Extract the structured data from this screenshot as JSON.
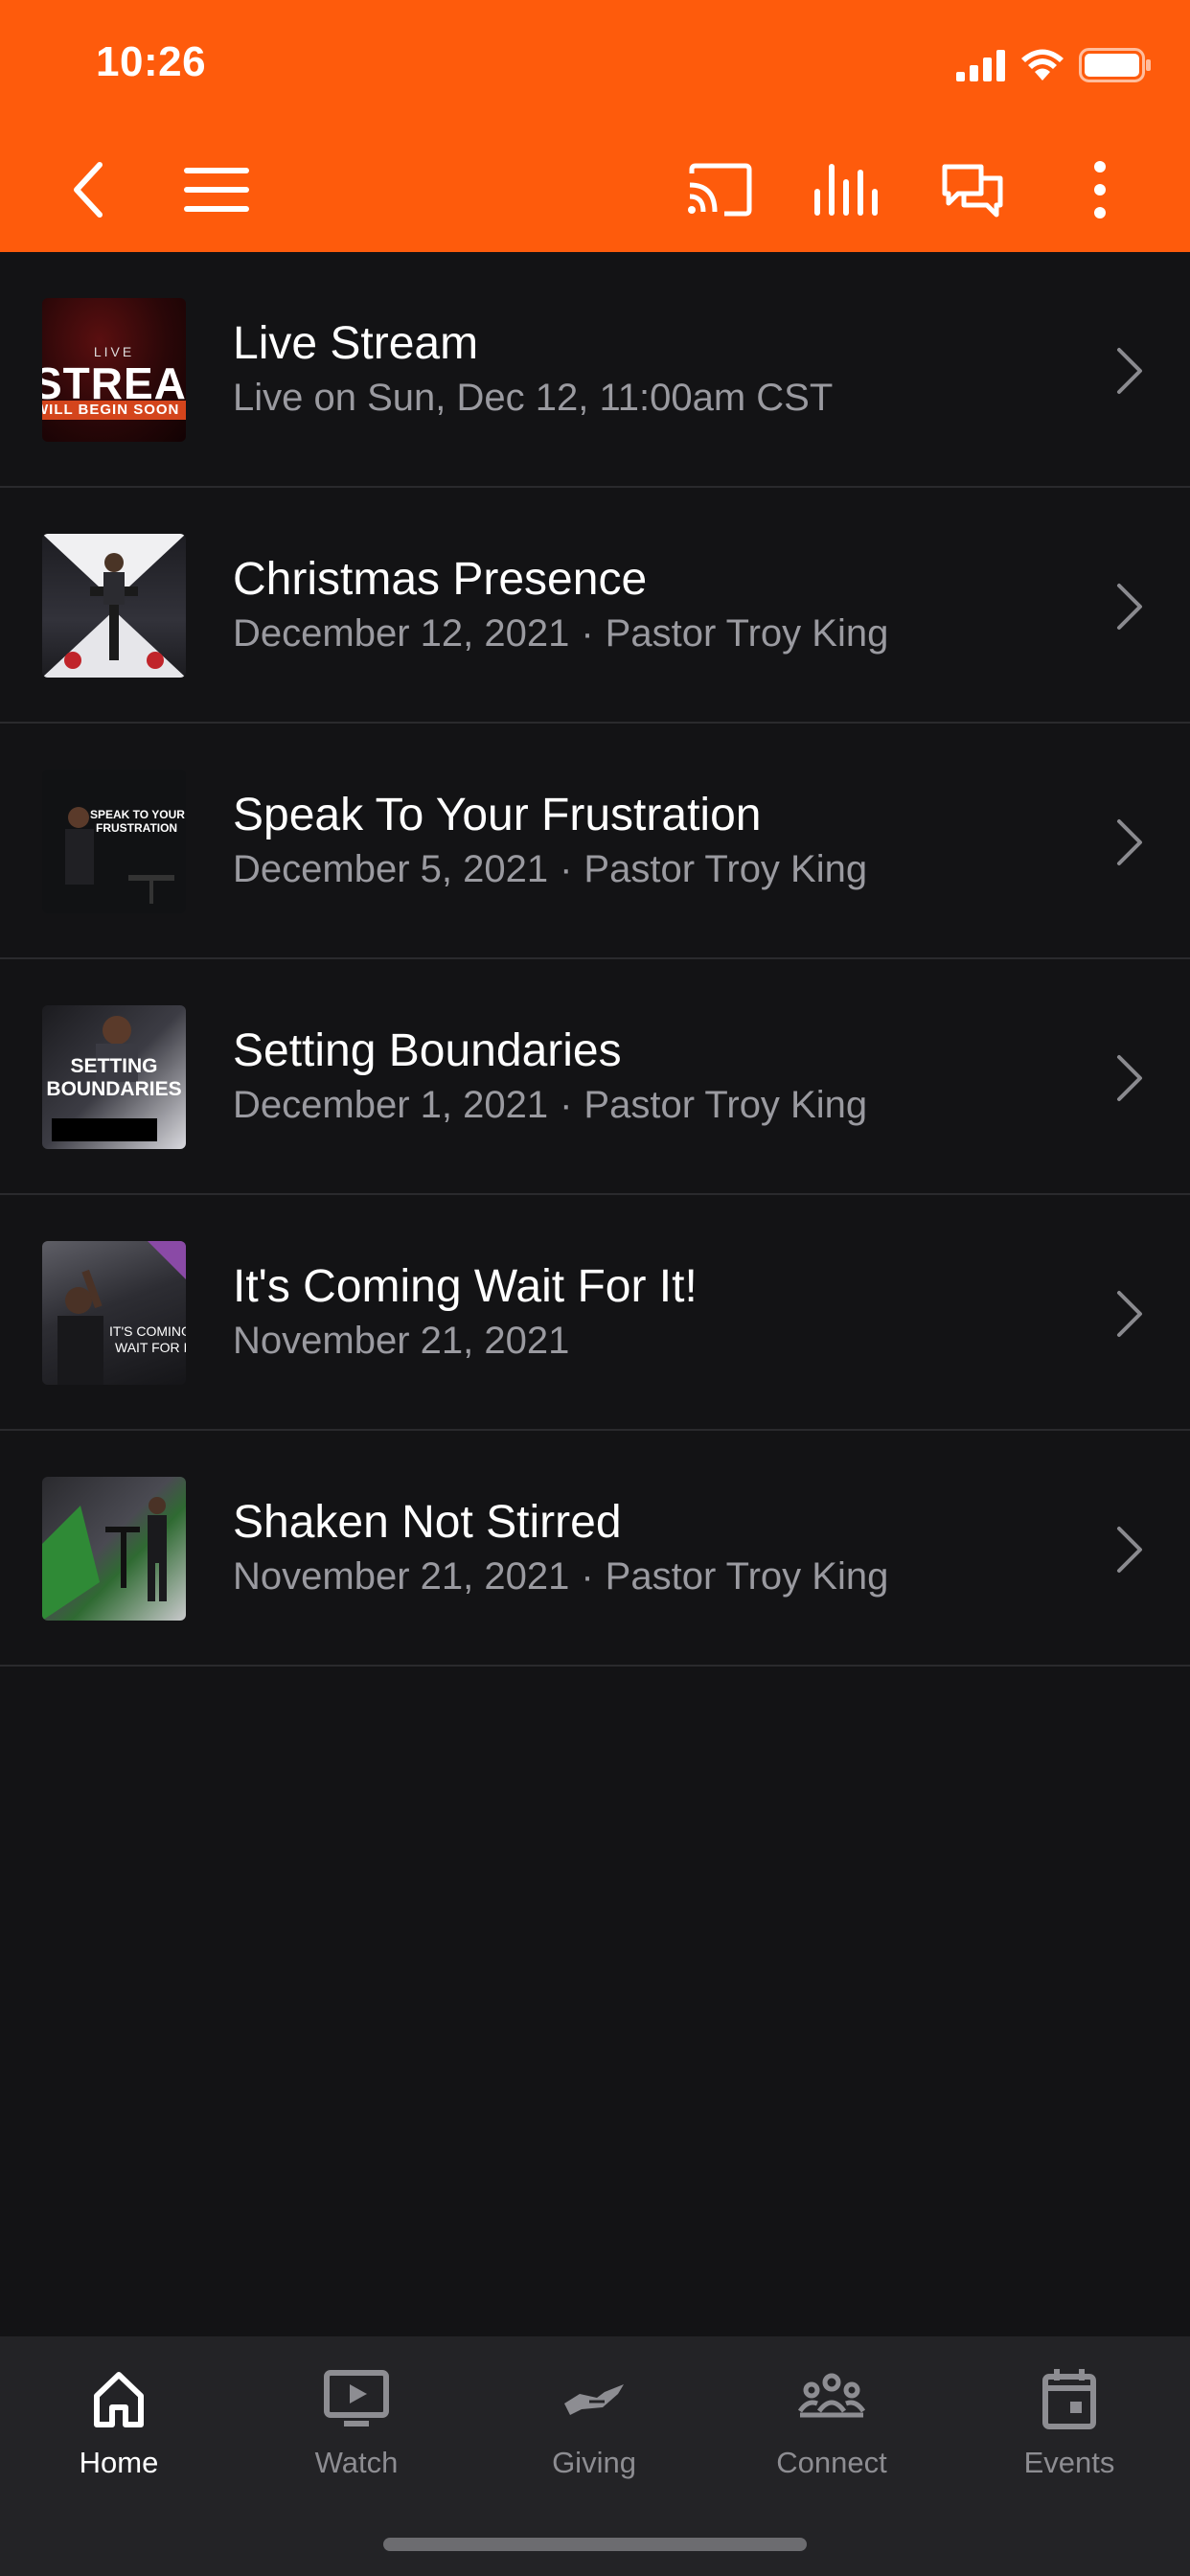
{
  "status_bar": {
    "time": "10:26"
  },
  "toolbar_icons": [
    "back-icon",
    "menu-icon",
    "cast-icon",
    "audio-icon",
    "chat-icon",
    "more-icon"
  ],
  "colors": {
    "accent": "#fe5b0c",
    "background": "#131315",
    "tabbar": "#232326",
    "subtitle": "#9a9aa0"
  },
  "items": [
    {
      "title": "Live Stream",
      "subtitle": "Live on Sun, Dec 12, 11:00am CST",
      "speaker": "",
      "thumb": {
        "line1": "LIVE",
        "line2": "STREAM",
        "line3": "WILL BEGIN SOON"
      }
    },
    {
      "title": "Christmas Presence",
      "subtitle": "December 12, 2021",
      "speaker": "Pastor Troy King"
    },
    {
      "title": "Speak To Your Frustration",
      "subtitle": "December 5, 2021",
      "speaker": "Pastor Troy King",
      "thumb": {
        "line1": "SPEAK TO YOUR",
        "line2": "FRUSTRATION"
      }
    },
    {
      "title": "Setting Boundaries",
      "subtitle": "December 1, 2021",
      "speaker": "Pastor Troy King",
      "thumb": {
        "line1": "SETTING",
        "line2": "BOUNDARIES"
      }
    },
    {
      "title": "It's Coming Wait For It!",
      "subtitle": "November 21, 2021",
      "speaker": "",
      "thumb": {
        "line1": "IT'S COMING",
        "line2": "WAIT FOR IT"
      }
    },
    {
      "title": "Shaken Not Stirred",
      "subtitle": "November 21, 2021",
      "speaker": "Pastor Troy King"
    }
  ],
  "tabs": [
    {
      "label": "Home",
      "icon": "home-icon",
      "active": true
    },
    {
      "label": "Watch",
      "icon": "watch-icon",
      "active": false
    },
    {
      "label": "Giving",
      "icon": "giving-icon",
      "active": false
    },
    {
      "label": "Connect",
      "icon": "connect-icon",
      "active": false
    },
    {
      "label": "Events",
      "icon": "events-icon",
      "active": false
    }
  ]
}
